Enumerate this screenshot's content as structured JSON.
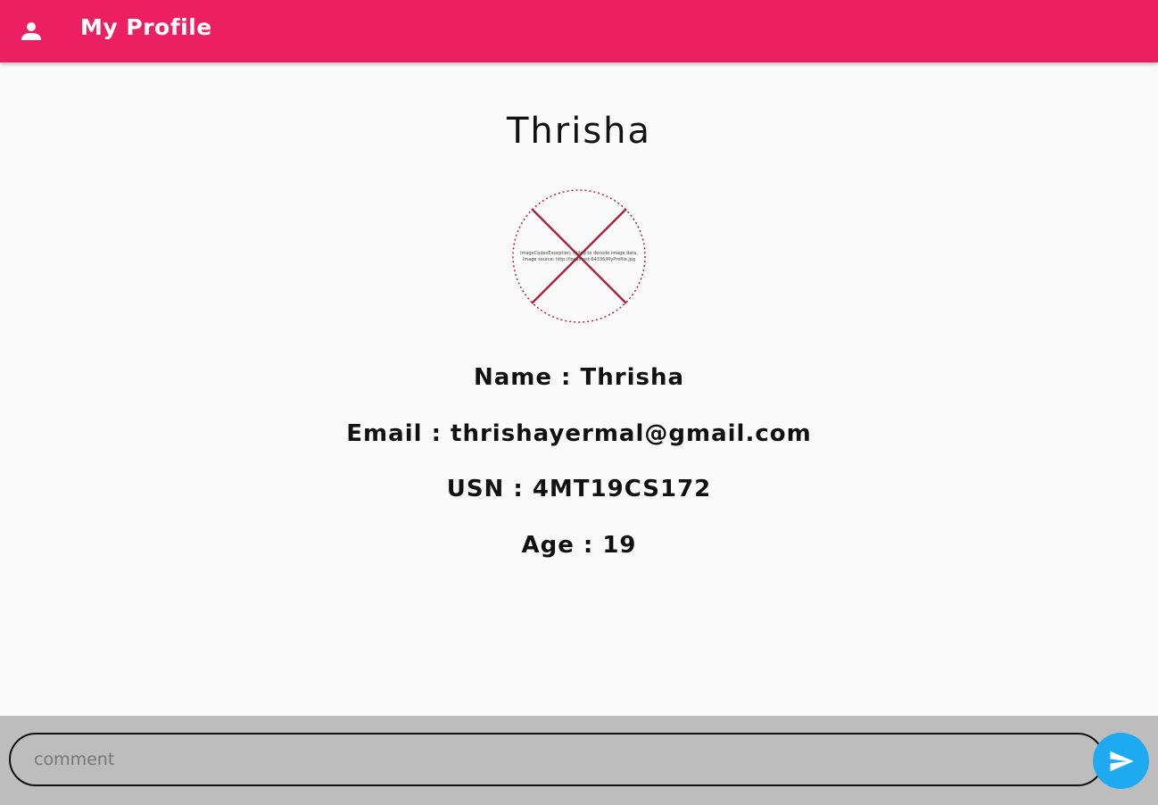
{
  "appbar": {
    "title": "My Profile",
    "icon": "person-icon",
    "color": "#ec1f63"
  },
  "profile": {
    "heading": "Thrisha",
    "image_error": {
      "line1": "ImageCodecException: Failed to decode image data.",
      "line2": "Image source: http://localhost:64336/MyProfile.jpg"
    },
    "name": "Name : Thrisha",
    "email": "Email : thrishayermal@gmail.com",
    "usn": "USN : 4MT19CS172",
    "age": "Age : 19"
  },
  "comment": {
    "placeholder": "comment",
    "value": "",
    "send_icon": "send-icon",
    "send_color": "#1eaaf1"
  }
}
